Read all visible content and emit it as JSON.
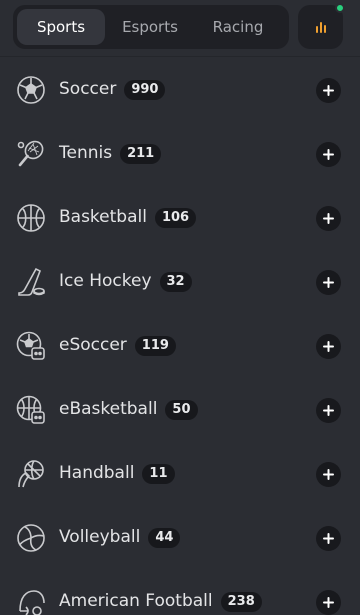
{
  "tabs": [
    {
      "label": "Sports",
      "active": true
    },
    {
      "label": "Esports",
      "active": false
    },
    {
      "label": "Racing",
      "active": false
    }
  ],
  "stats_button": {
    "icon": "bar-chart-icon",
    "notification": true,
    "accent": "#f0a030",
    "dot_color": "#29d07e"
  },
  "sports": [
    {
      "name": "Soccer",
      "count": "990",
      "icon": "soccer-ball-icon"
    },
    {
      "name": "Tennis",
      "count": "211",
      "icon": "tennis-racket-icon"
    },
    {
      "name": "Basketball",
      "count": "106",
      "icon": "basketball-icon"
    },
    {
      "name": "Ice Hockey",
      "count": "32",
      "icon": "hockey-stick-icon"
    },
    {
      "name": "eSoccer",
      "count": "119",
      "icon": "esoccer-icon"
    },
    {
      "name": "eBasketball",
      "count": "50",
      "icon": "ebasketball-icon"
    },
    {
      "name": "Handball",
      "count": "11",
      "icon": "handball-icon"
    },
    {
      "name": "Volleyball",
      "count": "44",
      "icon": "volleyball-icon"
    },
    {
      "name": "American Football",
      "count": "238",
      "icon": "american-football-icon"
    }
  ]
}
